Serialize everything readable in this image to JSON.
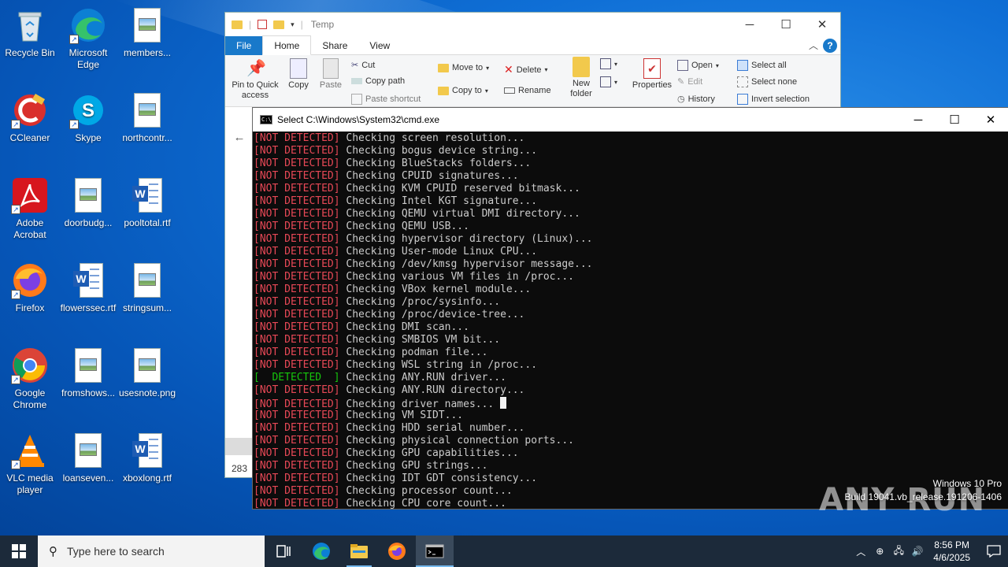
{
  "desktop": {
    "icons": [
      {
        "label": "Recycle Bin",
        "icon": "recycle-bin-icon"
      },
      {
        "label": "Microsoft Edge",
        "icon": "edge-icon"
      },
      {
        "label": "members...",
        "icon": "image-file-icon"
      },
      {
        "label": "CCleaner",
        "icon": "ccleaner-icon"
      },
      {
        "label": "Skype",
        "icon": "skype-icon"
      },
      {
        "label": "northcontr...",
        "icon": "image-file-icon"
      },
      {
        "label": "Adobe Acrobat",
        "icon": "acrobat-icon"
      },
      {
        "label": "doorbudg...",
        "icon": "image-file-icon"
      },
      {
        "label": "pooltotal.rtf",
        "icon": "word-file-icon"
      },
      {
        "label": "Firefox",
        "icon": "firefox-icon"
      },
      {
        "label": "flowerssec.rtf",
        "icon": "word-file-icon"
      },
      {
        "label": "stringsum...",
        "icon": "image-file-icon"
      },
      {
        "label": "Google Chrome",
        "icon": "chrome-icon"
      },
      {
        "label": "fromshows...",
        "icon": "image-file-icon"
      },
      {
        "label": "usesnote.png",
        "icon": "image-file-icon"
      },
      {
        "label": "VLC media player",
        "icon": "vlc-icon"
      },
      {
        "label": "loanseven...",
        "icon": "image-file-icon"
      },
      {
        "label": "xboxlong.rtf",
        "icon": "word-file-icon"
      }
    ]
  },
  "explorer": {
    "title": "Temp",
    "tabs": {
      "file": "File",
      "home": "Home",
      "share": "Share",
      "view": "View"
    },
    "ribbon": {
      "pin": "Pin to Quick access",
      "copy": "Copy",
      "paste": "Paste",
      "cut": "Cut",
      "copy_path": "Copy path",
      "paste_shortcut": "Paste shortcut",
      "move_to": "Move to",
      "copy_to": "Copy to",
      "delete": "Delete",
      "rename": "Rename",
      "new_folder": "New folder",
      "properties": "Properties",
      "open": "Open",
      "edit": "Edit",
      "history": "History",
      "select_all": "Select all",
      "select_none": "Select none",
      "invert_selection": "Invert selection"
    },
    "status_count": "283"
  },
  "cmd": {
    "title": "Select C:\\Windows\\System32\\cmd.exe",
    "lines": [
      {
        "tag": "[NOT DETECTED]",
        "status": "not",
        "text": " Checking screen resolution..."
      },
      {
        "tag": "[NOT DETECTED]",
        "status": "not",
        "text": " Checking bogus device string..."
      },
      {
        "tag": "[NOT DETECTED]",
        "status": "not",
        "text": " Checking BlueStacks folders..."
      },
      {
        "tag": "[NOT DETECTED]",
        "status": "not",
        "text": " Checking CPUID signatures..."
      },
      {
        "tag": "[NOT DETECTED]",
        "status": "not",
        "text": " Checking KVM CPUID reserved bitmask..."
      },
      {
        "tag": "[NOT DETECTED]",
        "status": "not",
        "text": " Checking Intel KGT signature..."
      },
      {
        "tag": "[NOT DETECTED]",
        "status": "not",
        "text": " Checking QEMU virtual DMI directory..."
      },
      {
        "tag": "[NOT DETECTED]",
        "status": "not",
        "text": " Checking QEMU USB..."
      },
      {
        "tag": "[NOT DETECTED]",
        "status": "not",
        "text": " Checking hypervisor directory (Linux)..."
      },
      {
        "tag": "[NOT DETECTED]",
        "status": "not",
        "text": " Checking User-mode Linux CPU..."
      },
      {
        "tag": "[NOT DETECTED]",
        "status": "not",
        "text": " Checking /dev/kmsg hypervisor message..."
      },
      {
        "tag": "[NOT DETECTED]",
        "status": "not",
        "text": " Checking various VM files in /proc..."
      },
      {
        "tag": "[NOT DETECTED]",
        "status": "not",
        "text": " Checking VBox kernel module..."
      },
      {
        "tag": "[NOT DETECTED]",
        "status": "not",
        "text": " Checking /proc/sysinfo..."
      },
      {
        "tag": "[NOT DETECTED]",
        "status": "not",
        "text": " Checking /proc/device-tree..."
      },
      {
        "tag": "[NOT DETECTED]",
        "status": "not",
        "text": " Checking DMI scan..."
      },
      {
        "tag": "[NOT DETECTED]",
        "status": "not",
        "text": " Checking SMBIOS VM bit..."
      },
      {
        "tag": "[NOT DETECTED]",
        "status": "not",
        "text": " Checking podman file..."
      },
      {
        "tag": "[NOT DETECTED]",
        "status": "not",
        "text": " Checking WSL string in /proc..."
      },
      {
        "tag": "[  DETECTED  ]",
        "status": "yes",
        "text": " Checking ANY.RUN driver..."
      },
      {
        "tag": "[NOT DETECTED]",
        "status": "not",
        "text": " Checking ANY.RUN directory..."
      },
      {
        "tag": "[NOT DETECTED]",
        "status": "not",
        "text": " Checking driver names... ",
        "cursor": true
      },
      {
        "tag": "[NOT DETECTED]",
        "status": "not",
        "text": " Checking VM SIDT..."
      },
      {
        "tag": "[NOT DETECTED]",
        "status": "not",
        "text": " Checking HDD serial number..."
      },
      {
        "tag": "[NOT DETECTED]",
        "status": "not",
        "text": " Checking physical connection ports..."
      },
      {
        "tag": "[NOT DETECTED]",
        "status": "not",
        "text": " Checking GPU capabilities..."
      },
      {
        "tag": "[NOT DETECTED]",
        "status": "not",
        "text": " Checking GPU strings..."
      },
      {
        "tag": "[NOT DETECTED]",
        "status": "not",
        "text": " Checking IDT GDT consistency..."
      },
      {
        "tag": "[NOT DETECTED]",
        "status": "not",
        "text": " Checking processor count..."
      },
      {
        "tag": "[NOT DETECTED]",
        "status": "not",
        "text": " Checking CPU core count..."
      }
    ]
  },
  "watermark": {
    "edition": "Windows 10 Pro",
    "build": "Build 19041.vb_release.191206-1406",
    "brand": "ANY RUN"
  },
  "taskbar": {
    "search_placeholder": "Type here to search",
    "time": "8:56 PM",
    "date": "4/6/2025"
  },
  "colors": {
    "desktop": "#0a63c9",
    "not_detected": "#e74856",
    "detected": "#16c60c",
    "taskbar": "#1c2a3a"
  }
}
